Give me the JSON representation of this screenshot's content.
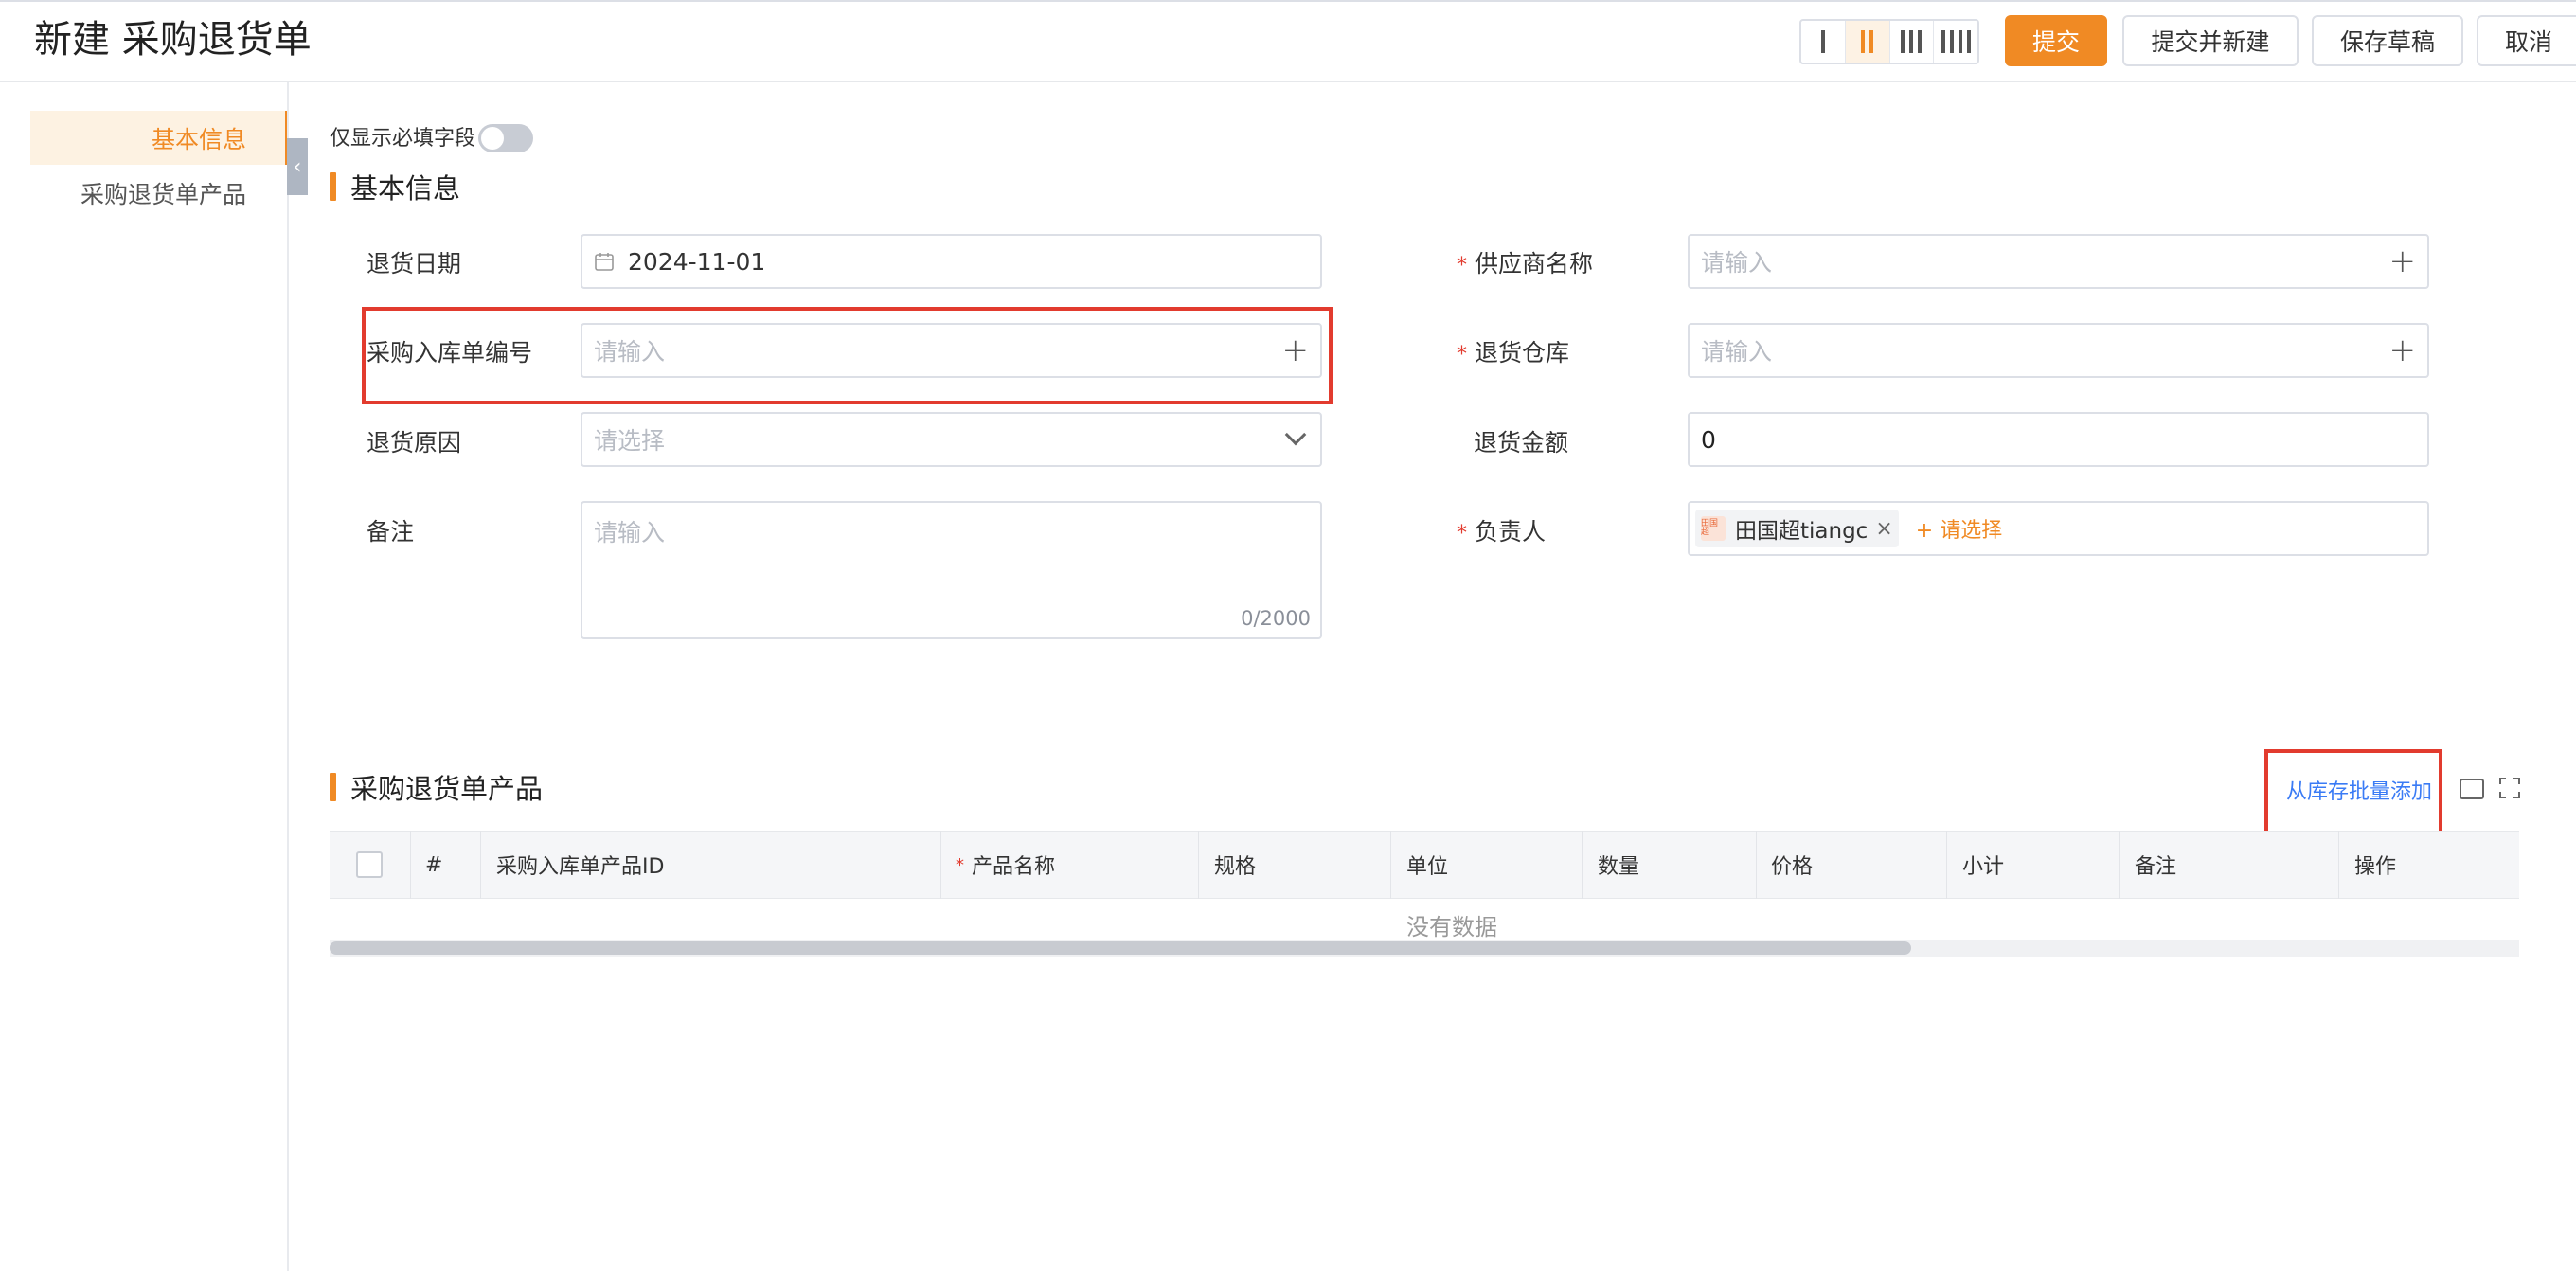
{
  "header": {
    "title": "新建 采购退货单",
    "buttons": {
      "submit": "提交",
      "submit_new": "提交并新建",
      "save_draft": "保存草稿",
      "cancel": "取消"
    }
  },
  "sidebar": {
    "items": [
      {
        "label": "基本信息",
        "active": true
      },
      {
        "label": "采购退货单产品",
        "active": false
      }
    ]
  },
  "toggle": {
    "label": "仅显示必填字段",
    "on": false
  },
  "section_basic": {
    "title": "基本信息"
  },
  "form": {
    "return_date": {
      "label": "退货日期",
      "value": "2024-11-01"
    },
    "inbound_no": {
      "label": "采购入库单编号",
      "placeholder": "请输入"
    },
    "return_reason": {
      "label": "退货原因",
      "placeholder": "请选择"
    },
    "remark": {
      "label": "备注",
      "placeholder": "请输入",
      "counter": "0/2000"
    },
    "supplier": {
      "label": "供应商名称",
      "placeholder": "请输入",
      "required": "*"
    },
    "warehouse": {
      "label": "退货仓库",
      "placeholder": "请输入",
      "required": "*"
    },
    "amount": {
      "label": "退货金额",
      "value": "0"
    },
    "owner": {
      "label": "负责人",
      "required": "*",
      "tag": "田国超tiangc",
      "avatar_text": "田国超",
      "add": "+ 请选择"
    }
  },
  "section_products": {
    "title": "采购退货单产品",
    "batch_add": "从库存批量添加",
    "columns": [
      "#",
      "采购入库单产品ID",
      "产品名称",
      "规格",
      "单位",
      "数量",
      "价格",
      "小计",
      "备注",
      "操作"
    ],
    "required_mark": "*",
    "empty": "没有数据"
  },
  "colors": {
    "accent": "#f08a24",
    "required": "#e23b2e",
    "link": "#3a7bf5",
    "highlight": "#e23b2e"
  }
}
